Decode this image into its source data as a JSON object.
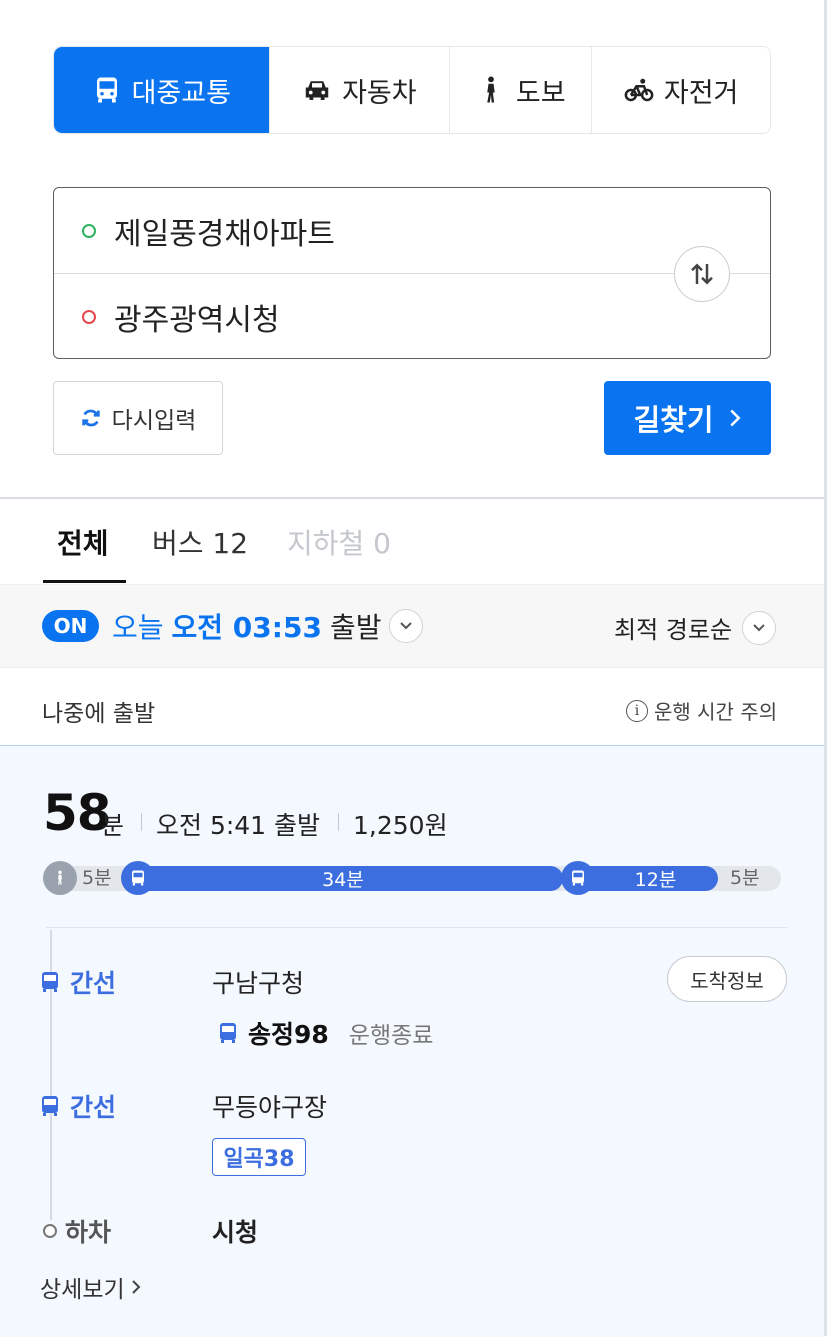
{
  "mode_tabs": [
    {
      "label": "대중교통",
      "icon": "bus-icon"
    },
    {
      "label": "자동차",
      "icon": "car-icon"
    },
    {
      "label": "도보",
      "icon": "walk-icon"
    },
    {
      "label": "자전거",
      "icon": "bicycle-icon"
    }
  ],
  "route": {
    "origin": "제일풍경채아파트",
    "destination": "광주광역시청"
  },
  "actions": {
    "reset_label": "다시입력",
    "search_label": "길찾기"
  },
  "category_tabs": [
    {
      "label": "전체"
    },
    {
      "label": "버스 12"
    },
    {
      "label": "지하철 0"
    }
  ],
  "departure": {
    "badge": "ON",
    "prefix": "오늘",
    "time": "오전 03:53",
    "suffix": "출발",
    "sort": "최적 경로순",
    "later": "나중에 출발",
    "notice": "운행 시간 주의"
  },
  "result": {
    "total_time": "58",
    "total_unit": "분",
    "depart_time": "오전 5:41 출발",
    "fare": "1,250원",
    "segments": [
      {
        "type": "walk",
        "label": "5분"
      },
      {
        "type": "bus",
        "label": "34분"
      },
      {
        "type": "bus",
        "label": "12분"
      },
      {
        "type": "walk",
        "label": "5분"
      }
    ],
    "steps": [
      {
        "type_label": "간선",
        "station": "구남구청",
        "bus": "송정98",
        "status": "운행종료",
        "arrive_label": "도착정보"
      },
      {
        "type_label": "간선",
        "station": "무등야구장",
        "bus": "일곡38"
      },
      {
        "type_label": "하차",
        "station": "시청"
      }
    ],
    "detail_label": "상세보기"
  },
  "colors": {
    "primary": "#0a74f0",
    "bus": "#3d6ee0",
    "origin_dot": "#2db35d",
    "dest_dot": "#e5484d"
  }
}
